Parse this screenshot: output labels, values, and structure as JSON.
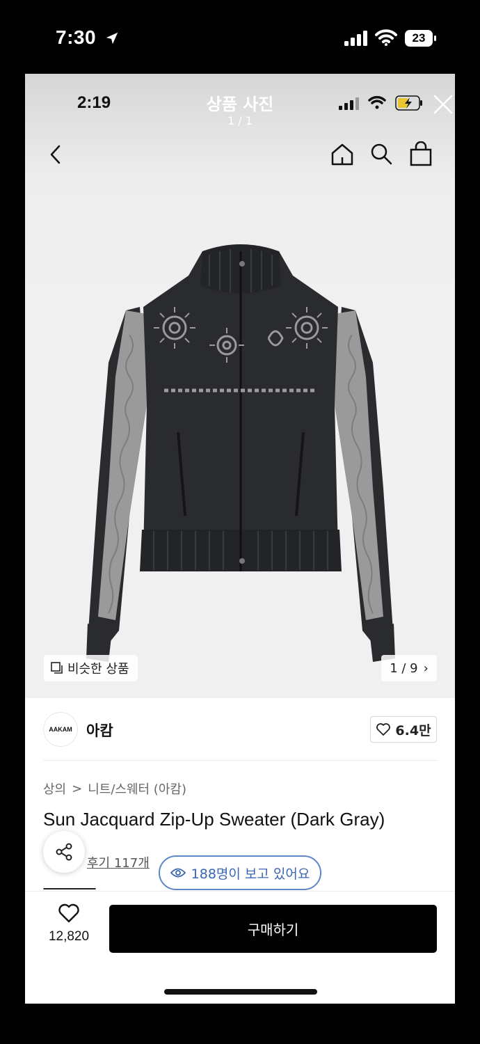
{
  "outer_status": {
    "time": "7:30",
    "battery": "23"
  },
  "inner_status": {
    "time": "2:19"
  },
  "viewer": {
    "title": "상품 사진",
    "count": "1 / 1"
  },
  "photo": {
    "similar_label": "비슷한 상품",
    "page_indicator": "1 / 9",
    "page_arrow": "›"
  },
  "brand": {
    "logo_text": "AAKAM",
    "name": "아캄",
    "likes": "6.4만"
  },
  "breadcrumb": {
    "level1": "상의",
    "separator": ">",
    "level2": "니트/스웨터 (아캄)"
  },
  "product": {
    "title": "Sun Jacquard Zip-Up Sweater (Dark Gray)"
  },
  "reviews": {
    "label": "후기 117개"
  },
  "viewers": {
    "text": "188명이 보고 있어요"
  },
  "bottom_bar": {
    "wish_count": "12,820",
    "buy_label": "구매하기"
  },
  "colors": {
    "accent_blue": "#3a66b3",
    "buy_button": "#000000",
    "sweater_body": "#2a2b2e",
    "sweater_sleeve": "#9a9a9a"
  },
  "icons": [
    "location-arrow-icon",
    "signal-icon",
    "wifi-icon",
    "battery-icon",
    "close-icon",
    "back-arrow-icon",
    "home-icon",
    "search-icon",
    "shopping-bag-icon",
    "similar-items-icon",
    "heart-icon",
    "share-icon",
    "eye-icon"
  ]
}
